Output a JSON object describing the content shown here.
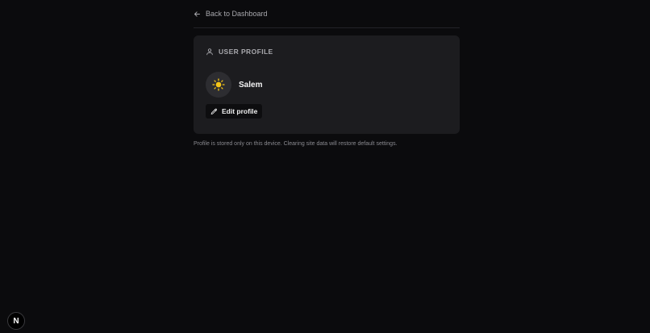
{
  "nav": {
    "back_label": "Back to Dashboard",
    "back_icon": "arrow-left-icon"
  },
  "card": {
    "header_icon": "user-icon",
    "header_label": "USER PROFILE",
    "avatar_icon": "sun-icon",
    "avatar_color": "#f5c518",
    "username": "Salem",
    "edit_icon": "pencil-icon",
    "edit_label": "Edit profile"
  },
  "footer_note": "Profile is stored only on this device. Clearing site data will restore default settings.",
  "dev_badge": {
    "letter": "N",
    "icon": "nextjs-icon"
  },
  "colors": {
    "background": "#0b0b0d",
    "card": "#1c1c1f",
    "muted_text": "#a8a8ad"
  }
}
